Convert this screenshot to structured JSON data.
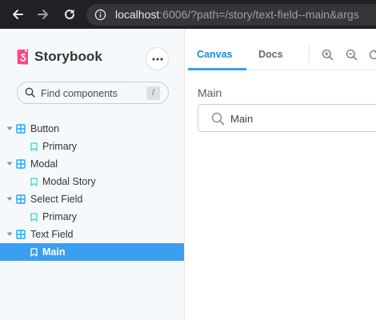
{
  "browser": {
    "url_host": "localhost",
    "url_rest": ":6006/?path=/story/text-field--main&args"
  },
  "sidebar": {
    "brand": "Storybook",
    "search_placeholder": "Find components",
    "search_shortcut": "/",
    "tree": [
      {
        "label": "Button",
        "stories": [
          {
            "label": "Primary"
          }
        ]
      },
      {
        "label": "Modal",
        "stories": [
          {
            "label": "Modal Story"
          }
        ]
      },
      {
        "label": "Select Field",
        "stories": [
          {
            "label": "Primary"
          }
        ]
      },
      {
        "label": "Text Field",
        "stories": [
          {
            "label": "Main",
            "selected": true
          }
        ]
      }
    ]
  },
  "toolbar": {
    "tabs": [
      {
        "label": "Canvas",
        "active": true
      },
      {
        "label": "Docs",
        "active": false
      }
    ]
  },
  "canvas": {
    "field_label": "Main",
    "field_value": "Main"
  },
  "colors": {
    "accent": "#3b9ff1",
    "brand": "#ff4785",
    "sidebar_bg": "#f6f9fc"
  }
}
